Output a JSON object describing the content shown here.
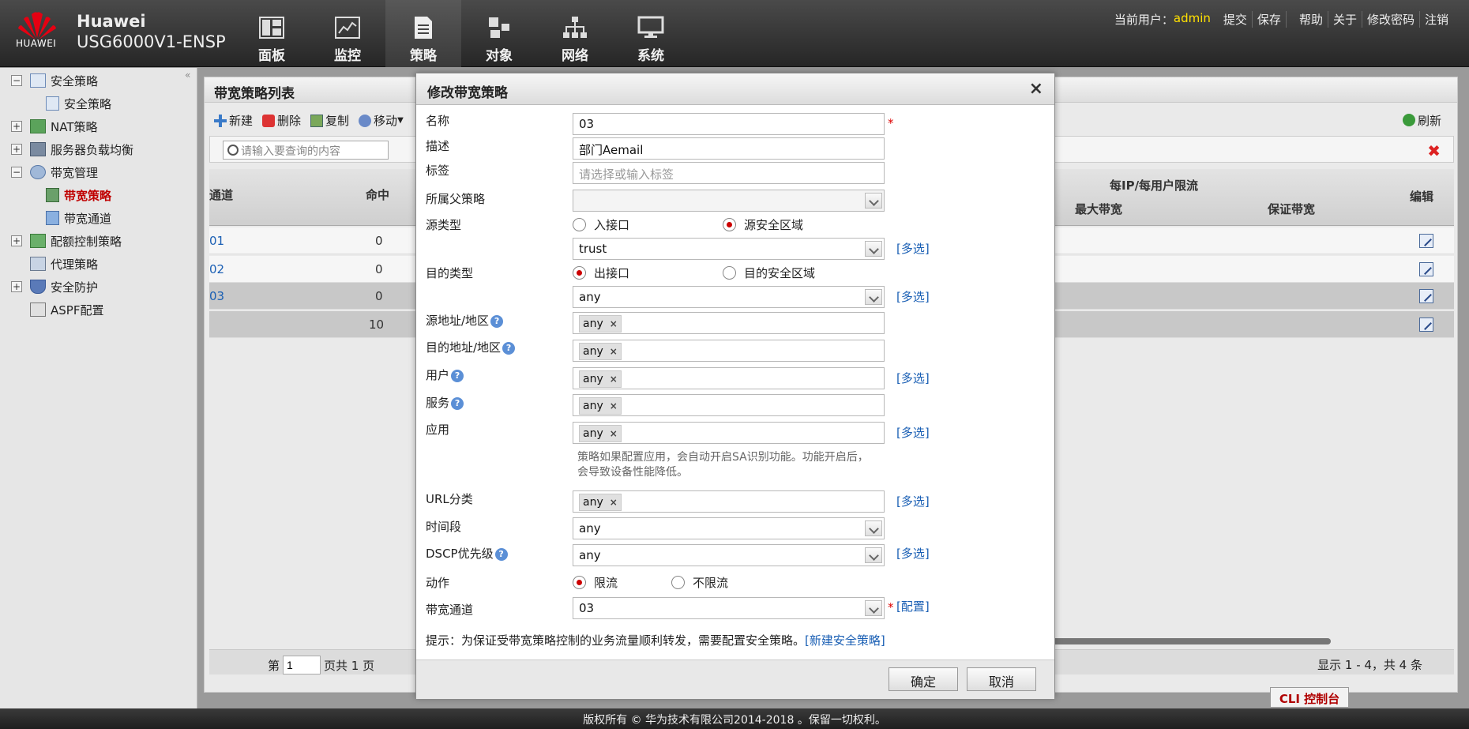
{
  "header": {
    "brand_line1": "Huawei",
    "brand_line2": "USG6000V1-ENSP",
    "logo_text": "HUAWEI",
    "nav": [
      {
        "label": "面板"
      },
      {
        "label": "监控"
      },
      {
        "label": "策略"
      },
      {
        "label": "对象"
      },
      {
        "label": "网络"
      },
      {
        "label": "系统"
      }
    ],
    "active_nav": "策略",
    "user_label": "当前用户：",
    "user": "admin",
    "links": [
      "提交",
      "保存",
      "帮助",
      "关于",
      "修改密码",
      "注销"
    ]
  },
  "sidebar": {
    "items": [
      {
        "label": "安全策略",
        "expander": "−"
      },
      {
        "label": "安全策略",
        "expander": ""
      },
      {
        "label": "NAT策略",
        "expander": "+"
      },
      {
        "label": "服务器负载均衡",
        "expander": "+"
      },
      {
        "label": "带宽管理",
        "expander": "−"
      },
      {
        "label": "带宽策略",
        "expander": ""
      },
      {
        "label": "带宽通道",
        "expander": ""
      },
      {
        "label": "配额控制策略",
        "expander": "+"
      },
      {
        "label": "代理策略",
        "expander": ""
      },
      {
        "label": "安全防护",
        "expander": "+"
      },
      {
        "label": "ASPF配置",
        "expander": ""
      }
    ],
    "collapse": "«"
  },
  "main": {
    "title": "带宽策略列表",
    "toolbar": [
      "新建",
      "删除",
      "复制",
      "移动"
    ],
    "refresh": "刷新",
    "search_placeholder": "请输入要查询的内容",
    "columns": {
      "channel": "通道",
      "hit": "命中",
      "per_ip": "每IP/每用户限流",
      "max_bw": "最大带宽",
      "guar_bw": "保证带宽",
      "edit": "编辑"
    },
    "rows": [
      {
        "id": "01",
        "hit": "0"
      },
      {
        "id": "02",
        "hit": "0"
      },
      {
        "id": "03",
        "hit": "0"
      },
      {
        "id": "",
        "hit": "10"
      }
    ],
    "pager": {
      "prefix": "第",
      "page": "1",
      "suffix": "页共 1 页",
      "count": "显示 1 - 4，共 4 条"
    }
  },
  "dialog": {
    "title": "修改带宽策略",
    "close": "×",
    "labels": {
      "name": "名称",
      "desc": "描述",
      "tag": "标签",
      "parent": "所属父策略",
      "src_type": "源类型",
      "dst_type": "目的类型",
      "src_addr": "源地址/地区",
      "dst_addr": "目的地址/地区",
      "user": "用户",
      "service": "服务",
      "app": "应用",
      "url": "URL分类",
      "time": "时间段",
      "dscp": "DSCP优先级",
      "action": "动作",
      "channel": "带宽通道"
    },
    "values": {
      "name": "03",
      "desc": "部门Aemail",
      "tag_placeholder": "请选择或输入标签",
      "parent": "",
      "src_zone": "trust",
      "dst_zone": "any",
      "src_addr": "any",
      "dst_addr": "any",
      "user": "any",
      "service": "any",
      "app": "any",
      "url": "any",
      "time": "any",
      "dscp": "any",
      "channel": "03"
    },
    "radios": {
      "src_in_if": "入接口",
      "src_zone": "源安全区域",
      "dst_out_if": "出接口",
      "dst_zone": "目的安全区域",
      "limit": "限流",
      "no_limit": "不限流"
    },
    "req": "*",
    "multi": "[多选]",
    "config": "[配置]",
    "help": "?",
    "tag_remove": "×",
    "app_note": "策略如果配置应用，会自动开启SA识别功能。功能开启后，会导致设备性能降低。",
    "tip": "提示：为保证受带宽策略控制的业务流量顺利转发，需要配置安全策略。",
    "tip_link": "[新建安全策略]",
    "ok": "确定",
    "cancel": "取消"
  },
  "footer": {
    "copyright": "版权所有 © 华为技术有限公司2014-2018 。保留一切权利。",
    "cli": "CLI 控制台"
  },
  "colors": {
    "accent_red": "#c00000",
    "link": "#1a5fb4",
    "user": "#ffe000"
  }
}
